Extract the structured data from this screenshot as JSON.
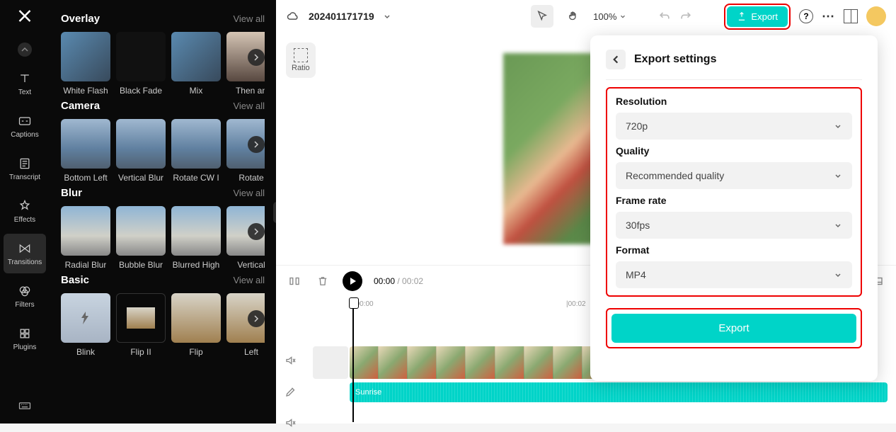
{
  "sidebar": {
    "items": [
      {
        "label": "Text"
      },
      {
        "label": "Captions"
      },
      {
        "label": "Transcript"
      },
      {
        "label": "Effects"
      },
      {
        "label": "Transitions"
      },
      {
        "label": "Filters"
      },
      {
        "label": "Plugins"
      }
    ]
  },
  "panel": {
    "view_all": "View all",
    "categories": [
      {
        "name": "Overlay",
        "items": [
          "White Flash",
          "Black Fade",
          "Mix",
          "Then an"
        ]
      },
      {
        "name": "Camera",
        "items": [
          "Bottom Left",
          "Vertical Blur",
          "Rotate CW I",
          "Rotate"
        ]
      },
      {
        "name": "Blur",
        "items": [
          "Radial Blur",
          "Bubble Blur",
          "Blurred High",
          "Vertical"
        ]
      },
      {
        "name": "Basic",
        "items": [
          "Blink",
          "Flip II",
          "Flip",
          "Left"
        ]
      }
    ]
  },
  "topbar": {
    "project_name": "202401171719",
    "zoom": "100%",
    "export_label": "Export"
  },
  "canvas": {
    "ratio_label": "Ratio"
  },
  "timeline": {
    "timecode_current": "00:00",
    "timecode_total": "00:02",
    "ruler_ticks": [
      "|00:00",
      "|00:02"
    ],
    "audio_clip": "Sunrise"
  },
  "export_panel": {
    "title": "Export settings",
    "fields": {
      "resolution": {
        "label": "Resolution",
        "value": "720p"
      },
      "quality": {
        "label": "Quality",
        "value": "Recommended quality"
      },
      "framerate": {
        "label": "Frame rate",
        "value": "30fps"
      },
      "format": {
        "label": "Format",
        "value": "MP4"
      }
    },
    "export_button": "Export"
  }
}
